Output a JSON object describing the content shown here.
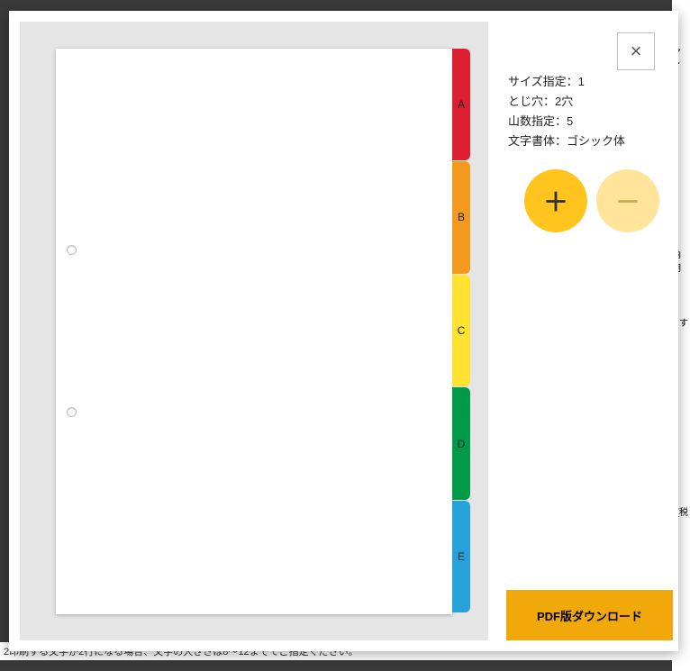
{
  "bottom_text": "2印刷する文字が2行になる場合、文字の大きさは8～12までてご指定ください。",
  "info": {
    "size_label": "サイズ指定：",
    "size_value": "1",
    "holes_label": "とじ穴：",
    "holes_value": "2穴",
    "tabs_label": "山数指定：",
    "tabs_value": "5",
    "font_label": "文字書体：",
    "font_value": "ゴシック体"
  },
  "tabs": {
    "a": "A",
    "b": "B",
    "c": "C",
    "d": "D",
    "e": "E"
  },
  "buttons": {
    "download": "PDF版ダウンロード",
    "close": "×",
    "plus": "＋",
    "minus": "－"
  },
  "side_labels": {
    "top": "アイ",
    "mid1": "納期",
    "mid2": "す",
    "mid3": "(税"
  }
}
